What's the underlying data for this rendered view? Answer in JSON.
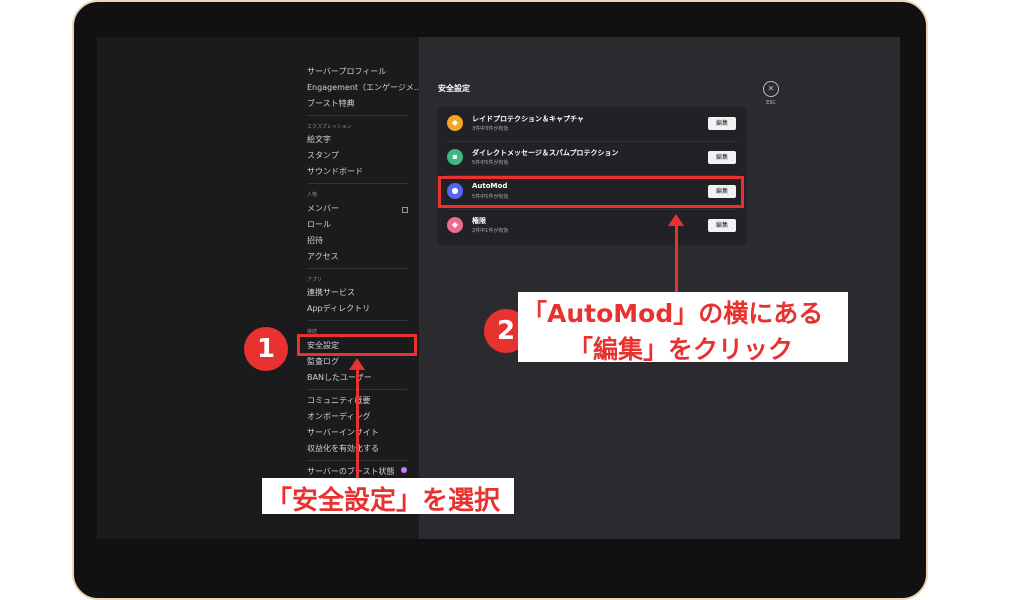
{
  "sidebar": {
    "groups": [
      {
        "header": "",
        "items": [
          "サーバープロフィール",
          "Engagement（エンゲージメ...",
          "ブースト特典"
        ]
      },
      {
        "header": "エクスプレッション",
        "items": [
          "絵文字",
          "スタンプ",
          "サウンドボード"
        ]
      },
      {
        "header": "人物",
        "items": [
          "メンバー",
          "ロール",
          "招待",
          "アクセス"
        ]
      },
      {
        "header": "アプリ",
        "items": [
          "連携サービス",
          "Appディレクトリ"
        ]
      },
      {
        "header": "接続",
        "items": [
          "安全設定",
          "監査ログ",
          "BANしたユーザー"
        ]
      },
      {
        "header": "",
        "items": [
          "コミュニティ概要",
          "オンボーディング",
          "サーバーインサイト",
          "収益化を有効化する"
        ]
      },
      {
        "header": "",
        "items": [
          "サーバーのブースト状態"
        ]
      }
    ]
  },
  "content": {
    "title": "安全設定",
    "close_label": "ESC",
    "rows": [
      {
        "name": "レイドプロテクション＆キャプチャ",
        "sub": "3件中3件が有効",
        "button": "編集",
        "icon": "shield-icon",
        "color": "#f5a623"
      },
      {
        "name": "ダイレクトメッセージ＆スパムプロテクション",
        "sub": "5件中5件が有効",
        "button": "編集",
        "icon": "chat-icon",
        "color": "#43b581"
      },
      {
        "name": "AutoMod",
        "sub": "5件中5件が有効",
        "button": "編集",
        "icon": "automod-icon",
        "color": "#5865f2"
      },
      {
        "name": "権限",
        "sub": "2件中1件が有効",
        "button": "編集",
        "icon": "lock-shield-icon",
        "color": "#ed6b8f"
      }
    ]
  },
  "annotations": {
    "step1_number": "1",
    "step1_text": "「安全設定」を選択",
    "step2_number": "2",
    "step2_line1": "「AutoMod」の横にある",
    "step2_line2": "「編集」をクリック",
    "accent_color": "#e8322f"
  }
}
